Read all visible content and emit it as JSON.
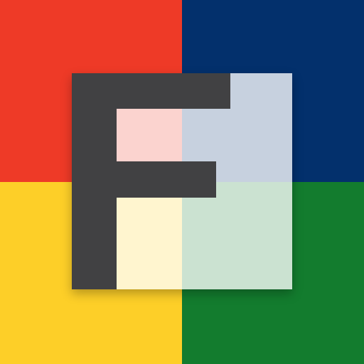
{
  "icon": {
    "name": "f-app-icon",
    "colors": {
      "top_left": "#ee3a27",
      "top_right": "#03306c",
      "bottom_left": "#fdcf28",
      "bottom_right": "#137c2e",
      "letter": "#414143",
      "overlay": "#ffffff"
    }
  }
}
